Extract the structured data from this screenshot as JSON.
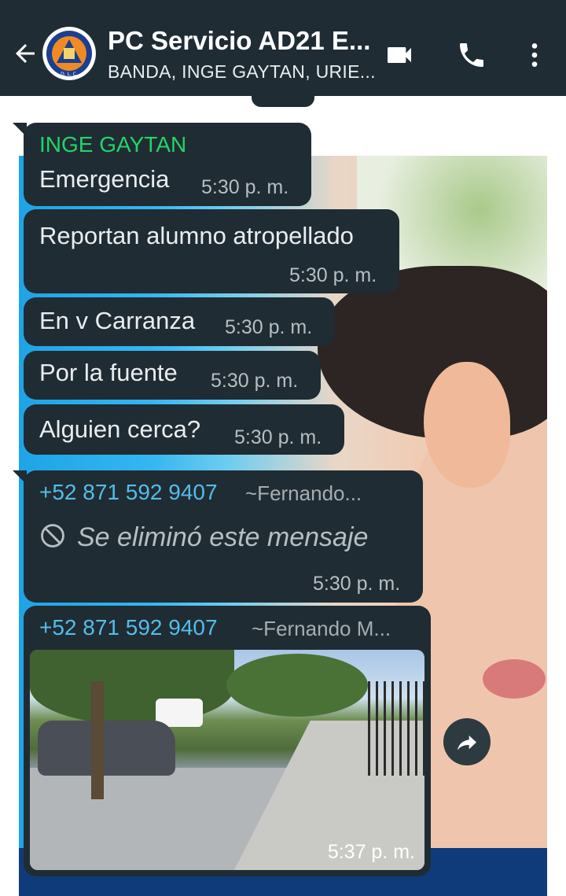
{
  "header": {
    "title": "PC Servicio AD21 E...",
    "subtitle": "BANDA, INGE GAYTAN, URIE...",
    "avatar_label": "D. L. C."
  },
  "colors": {
    "header_bg": "#1f2c34",
    "bubble_bg": "#202c33",
    "sender_green": "#25d366",
    "sender_teal": "#53bdeb"
  },
  "messages": [
    {
      "sender": "INGE GAYTAN",
      "text": "Emergencia",
      "time": "5:30 p. m."
    },
    {
      "text": "Reportan alumno atropellado",
      "time": "5:30 p. m."
    },
    {
      "text": "En v Carranza",
      "time": "5:30 p. m."
    },
    {
      "text": "Por la fuente",
      "time": "5:30 p. m."
    },
    {
      "text": "Alguien cerca?",
      "time": "5:30 p. m."
    },
    {
      "sender": "+52 871 592 9407",
      "sender_name": "~Fernando...",
      "text": "Se eliminó este mensaje",
      "time": "5:30 p. m."
    },
    {
      "sender": "+52 871 592 9407",
      "sender_name": "~Fernando M...",
      "time": "5:37 p. m."
    }
  ]
}
